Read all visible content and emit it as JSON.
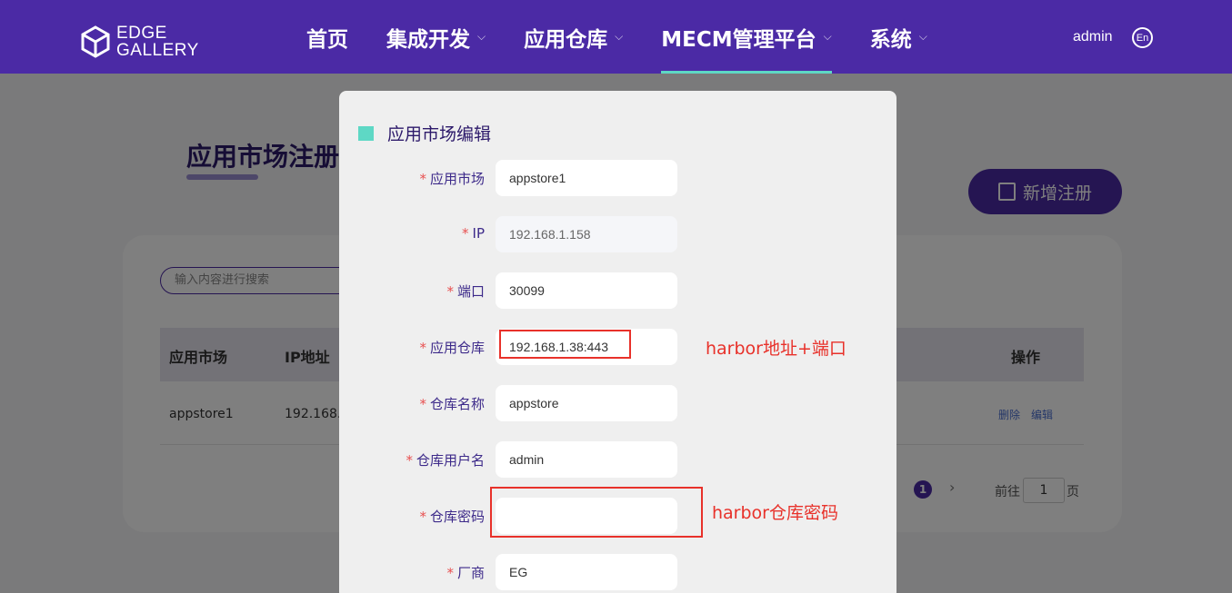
{
  "header": {
    "logo": "EDGE GALLERY",
    "logo_line1": "EDGE",
    "logo_line2": "GALLERY",
    "nav": [
      {
        "label": "首页"
      },
      {
        "label": "集成开发"
      },
      {
        "label": "应用仓库"
      },
      {
        "label": "MECM管理平台"
      },
      {
        "label": "系统"
      }
    ],
    "user": "admin",
    "lang": "En"
  },
  "page": {
    "title": "应用市场注册",
    "add_button": "新增注册",
    "search_placeholder": "输入内容进行搜索",
    "table": {
      "headers": [
        "应用市场",
        "IP地址",
        "操作"
      ],
      "rows": [
        {
          "name": "appstore1",
          "ip": "192.168.1",
          "delete": "删除",
          "edit": "编辑"
        }
      ]
    },
    "pager": {
      "current": "1",
      "goto_label": "前往",
      "goto_value": "1",
      "page_label": "页"
    }
  },
  "dialog": {
    "title": "应用市场编辑",
    "fields": [
      {
        "label": "应用市场",
        "value": "appstore1"
      },
      {
        "label": "IP",
        "value": "192.168.1.158"
      },
      {
        "label": "端口",
        "value": "30099"
      },
      {
        "label": "应用仓库",
        "value": "192.168.1.38:443"
      },
      {
        "label": "仓库名称",
        "value": "appstore"
      },
      {
        "label": "仓库用户名",
        "value": "admin"
      },
      {
        "label": "仓库密码",
        "value": ""
      },
      {
        "label": "厂商",
        "value": "EG"
      }
    ],
    "required_mark": "*"
  },
  "annotations": {
    "repo_note": "harbor地址+端口",
    "password_note": "harbor仓库密码",
    "color": "#e8312a"
  },
  "colors": {
    "brand": "#4b2aa5",
    "accent": "#5ed8c5"
  }
}
